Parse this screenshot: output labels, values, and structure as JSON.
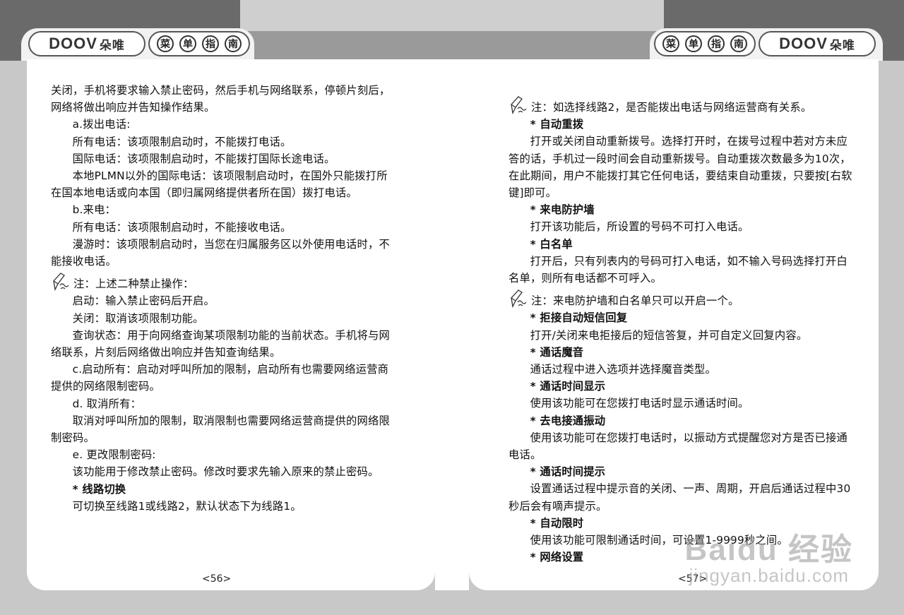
{
  "header": {
    "brand": "DOOV",
    "brand_cn": "朵唯",
    "guide_chars": [
      "菜",
      "单",
      "指",
      "南"
    ]
  },
  "left_page": {
    "paragraphs": [
      "关闭，手机将要求输入禁止密码，然后手机与网络联系，停顿片刻后，网络将做出响应并告知操作结果。",
      "a.拨出电话:",
      "所有电话：该项限制启动时，不能拨打电话。",
      "国际电话：该项限制启动时，不能拨打国际长途电话。",
      "本地PLMN以外的国际电话：该项限制启动时，在国外只能拨打所在国本地电话或向本国（即归属网络提供者所在国）拨打电话。",
      "b.来电：",
      "所有电话：该项限制启动时，不能接收电话。",
      "漫游时：该项限制启动时，当您在归属服务区以外使用电话时，不能接收电话。",
      "注：上述二种禁止操作：",
      "启动：输入禁止密码后开启。",
      "关闭：取消该项限制功能。",
      "查询状态：用于向网络查询某项限制功能的当前状态。手机将与网络联系，片刻后网络做出响应并告知查询结果。",
      "c.启动所有：启动对呼叫所加的限制，启动所有也需要网络运营商提供的网络限制密码。",
      "d. 取消所有：",
      "取消对呼叫所加的限制，取消限制也需要网络运营商提供的网络限制密码。",
      "e. 更改限制密码:",
      "该功能用于修改禁止密码。修改时要求先输入原来的禁止密码。",
      "* 线路切换",
      "可切换至线路1或线路2，默认状态下为线路1。"
    ],
    "page_number": "<56>"
  },
  "right_page": {
    "paragraphs": [
      "注：如选择线路2，是否能拨出电话与网络运营商有关系。",
      "* 自动重拨",
      "打开或关闭自动重新拨号。选择打开时，在拨号过程中若对方未应答的话，手机过一段时间会自动重新拨号。自动重拨次数最多为10次，在此期间，用户不能拨打其它任何电话，要结束自动重拨，只要按[右软键]即可。",
      "* 来电防护墙",
      "打开该功能后，所设置的号码不可打入电话。",
      "* 白名单",
      "打开后，只有列表内的号码可打入电话，如不输入号码选择打开白名单，则所有电话都不可呼入。",
      "注：来电防护墙和白名单只可以开启一个。",
      "* 拒接自动短信回复",
      "打开/关闭来电拒接后的短信答复，并可自定义回复内容。",
      "* 通话魔音",
      "通话过程中进入选项并选择魔音类型。",
      "* 通话时间显示",
      "使用该功能可在您拨打电话时显示通话时间。",
      "* 去电接通振动",
      "使用该功能可在您拨打电话时，以振动方式提醒您对方是否已接通电话。",
      "* 通话时间提示",
      "设置通话过程中提示音的关闭、一声、周期，开启后通话过程中30秒后会有嘀声提示。",
      "* 自动限时",
      "使用该功能可限制通话时间，可设置1-9999秒之间。",
      "* 网络设置"
    ],
    "page_number": "<57>"
  },
  "watermark": {
    "line1": "Baidu 经验",
    "line2": "jingyan.baidu.com"
  }
}
